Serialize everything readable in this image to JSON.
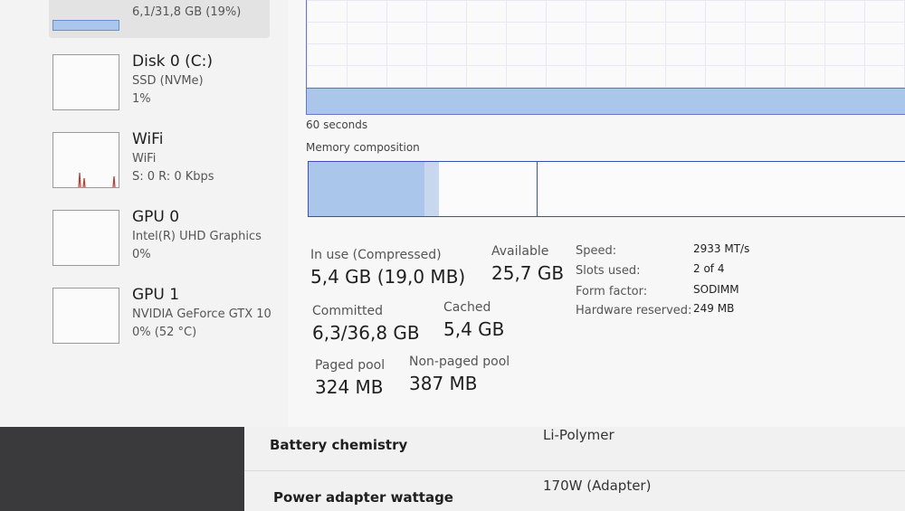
{
  "sidebar": {
    "items": [
      {
        "id": "memory",
        "title": "",
        "sub1": "6,1/31,8 GB (19%)",
        "sub2": ""
      },
      {
        "id": "disk0",
        "title": "Disk 0 (C:)",
        "sub1": "SSD (NVMe)",
        "sub2": "1%"
      },
      {
        "id": "wifi",
        "title": "WiFi",
        "sub1": "WiFi",
        "sub2": "S: 0 R: 0 Kbps"
      },
      {
        "id": "gpu0",
        "title": "GPU 0",
        "sub1": "Intel(R) UHD Graphics",
        "sub2": "0%"
      },
      {
        "id": "gpu1",
        "title": "GPU 1",
        "sub1": "NVIDIA GeForce GTX 10",
        "sub2": "0% (52 °C)"
      }
    ]
  },
  "memory": {
    "graph_axis_label": "60 seconds",
    "composition_label": "Memory composition",
    "in_use_label": "In use (Compressed)",
    "in_use_value": "5,4 GB (19,0 MB)",
    "available_label": "Available",
    "available_value": "25,7 GB",
    "committed_label": "Committed",
    "committed_value": "6,3/36,8 GB",
    "cached_label": "Cached",
    "cached_value": "5,4 GB",
    "paged_label": "Paged pool",
    "paged_value": "324 MB",
    "nonpaged_label": "Non-paged pool",
    "nonpaged_value": "387 MB",
    "details": [
      {
        "key": "Speed:",
        "value": "2933 MT/s"
      },
      {
        "key": "Slots used:",
        "value": "2 of 4"
      },
      {
        "key": "Form factor:",
        "value": "SODIMM"
      },
      {
        "key": "Hardware reserved:",
        "value": "249 MB"
      }
    ]
  },
  "settings": {
    "rows": [
      {
        "label": "Battery chemistry",
        "value": "Li-Polymer"
      },
      {
        "label": "Power adapter wattage",
        "value": "170W (Adapter)"
      }
    ]
  },
  "colors": {
    "accent": "#3c4fb4",
    "fill": "#aac6ea"
  }
}
